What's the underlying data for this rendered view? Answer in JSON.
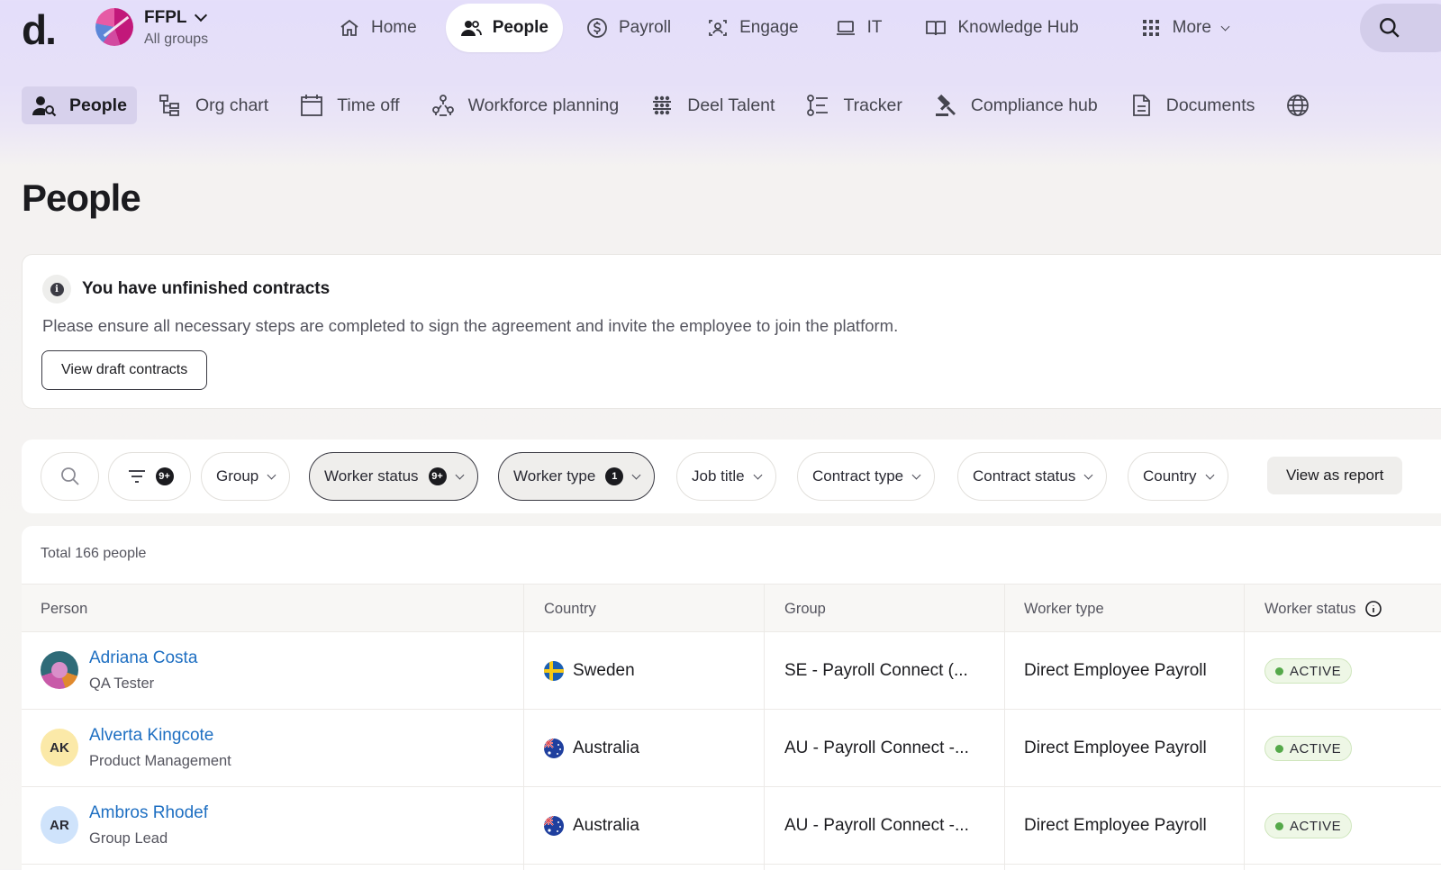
{
  "brand": {
    "logo": "d."
  },
  "org": {
    "name": "FFPL",
    "subtitle": "All groups"
  },
  "top_nav": [
    {
      "label": "Home",
      "icon": "home-icon"
    },
    {
      "label": "People",
      "icon": "people-icon",
      "active": true
    },
    {
      "label": "Payroll",
      "icon": "dollar-icon"
    },
    {
      "label": "Engage",
      "icon": "engage-icon"
    },
    {
      "label": "IT",
      "icon": "laptop-icon"
    },
    {
      "label": "Knowledge Hub",
      "icon": "book-icon"
    },
    {
      "label": "More",
      "icon": "grid-icon"
    }
  ],
  "sub_nav": [
    {
      "label": "People",
      "icon": "person-search-icon",
      "active": true
    },
    {
      "label": "Org chart",
      "icon": "org-chart-icon"
    },
    {
      "label": "Time off",
      "icon": "calendar-icon"
    },
    {
      "label": "Workforce planning",
      "icon": "workforce-icon"
    },
    {
      "label": "Deel Talent",
      "icon": "talent-icon"
    },
    {
      "label": "Tracker",
      "icon": "tracker-icon"
    },
    {
      "label": "Compliance hub",
      "icon": "gavel-icon"
    },
    {
      "label": "Documents",
      "icon": "document-icon"
    },
    {
      "label": "",
      "icon": "globe-icon"
    }
  ],
  "page": {
    "title": "People"
  },
  "banner": {
    "title": "You have unfinished contracts",
    "text": "Please ensure all necessary steps are completed to sign the agreement and invite the employee to join the platform.",
    "button": "View draft contracts"
  },
  "filters": {
    "filter_count": "9+",
    "chips": [
      {
        "label": "Group"
      },
      {
        "label": "Worker status",
        "count": "9+",
        "selected": true
      },
      {
        "label": "Worker type",
        "count": "1",
        "selected": true
      },
      {
        "label": "Job title"
      },
      {
        "label": "Contract type"
      },
      {
        "label": "Contract status"
      },
      {
        "label": "Country"
      }
    ],
    "report_button": "View as report"
  },
  "table": {
    "total": "Total 166 people",
    "columns": [
      "Person",
      "Country",
      "Group",
      "Worker type",
      "Worker status"
    ],
    "rows": [
      {
        "name": "Adriana Costa",
        "title": "QA Tester",
        "initials": "",
        "country": "Sweden",
        "flag": "sweden-flag-icon",
        "group": "SE - Payroll Connect (...",
        "worker_type": "Direct Employee Payroll",
        "status": "ACTIVE"
      },
      {
        "name": "Alverta Kingcote",
        "title": "Product Management",
        "initials": "AK",
        "country": "Australia",
        "flag": "australia-flag-icon",
        "group": "AU - Payroll Connect -...",
        "worker_type": "Direct Employee Payroll",
        "status": "ACTIVE"
      },
      {
        "name": "Ambros Rhodef",
        "title": "Group Lead",
        "initials": "AR",
        "country": "Australia",
        "flag": "australia-flag-icon",
        "group": "AU - Payroll Connect -...",
        "worker_type": "Direct Employee Payroll",
        "status": "ACTIVE"
      }
    ]
  },
  "colors": {
    "header_bg": "#e4defa",
    "link": "#1e6fc2",
    "active_badge_bg": "#eef7e6",
    "active_dot": "#55a94a",
    "avatar_ak": "#fbe9a8",
    "avatar_ar": "#cfe3fb"
  }
}
